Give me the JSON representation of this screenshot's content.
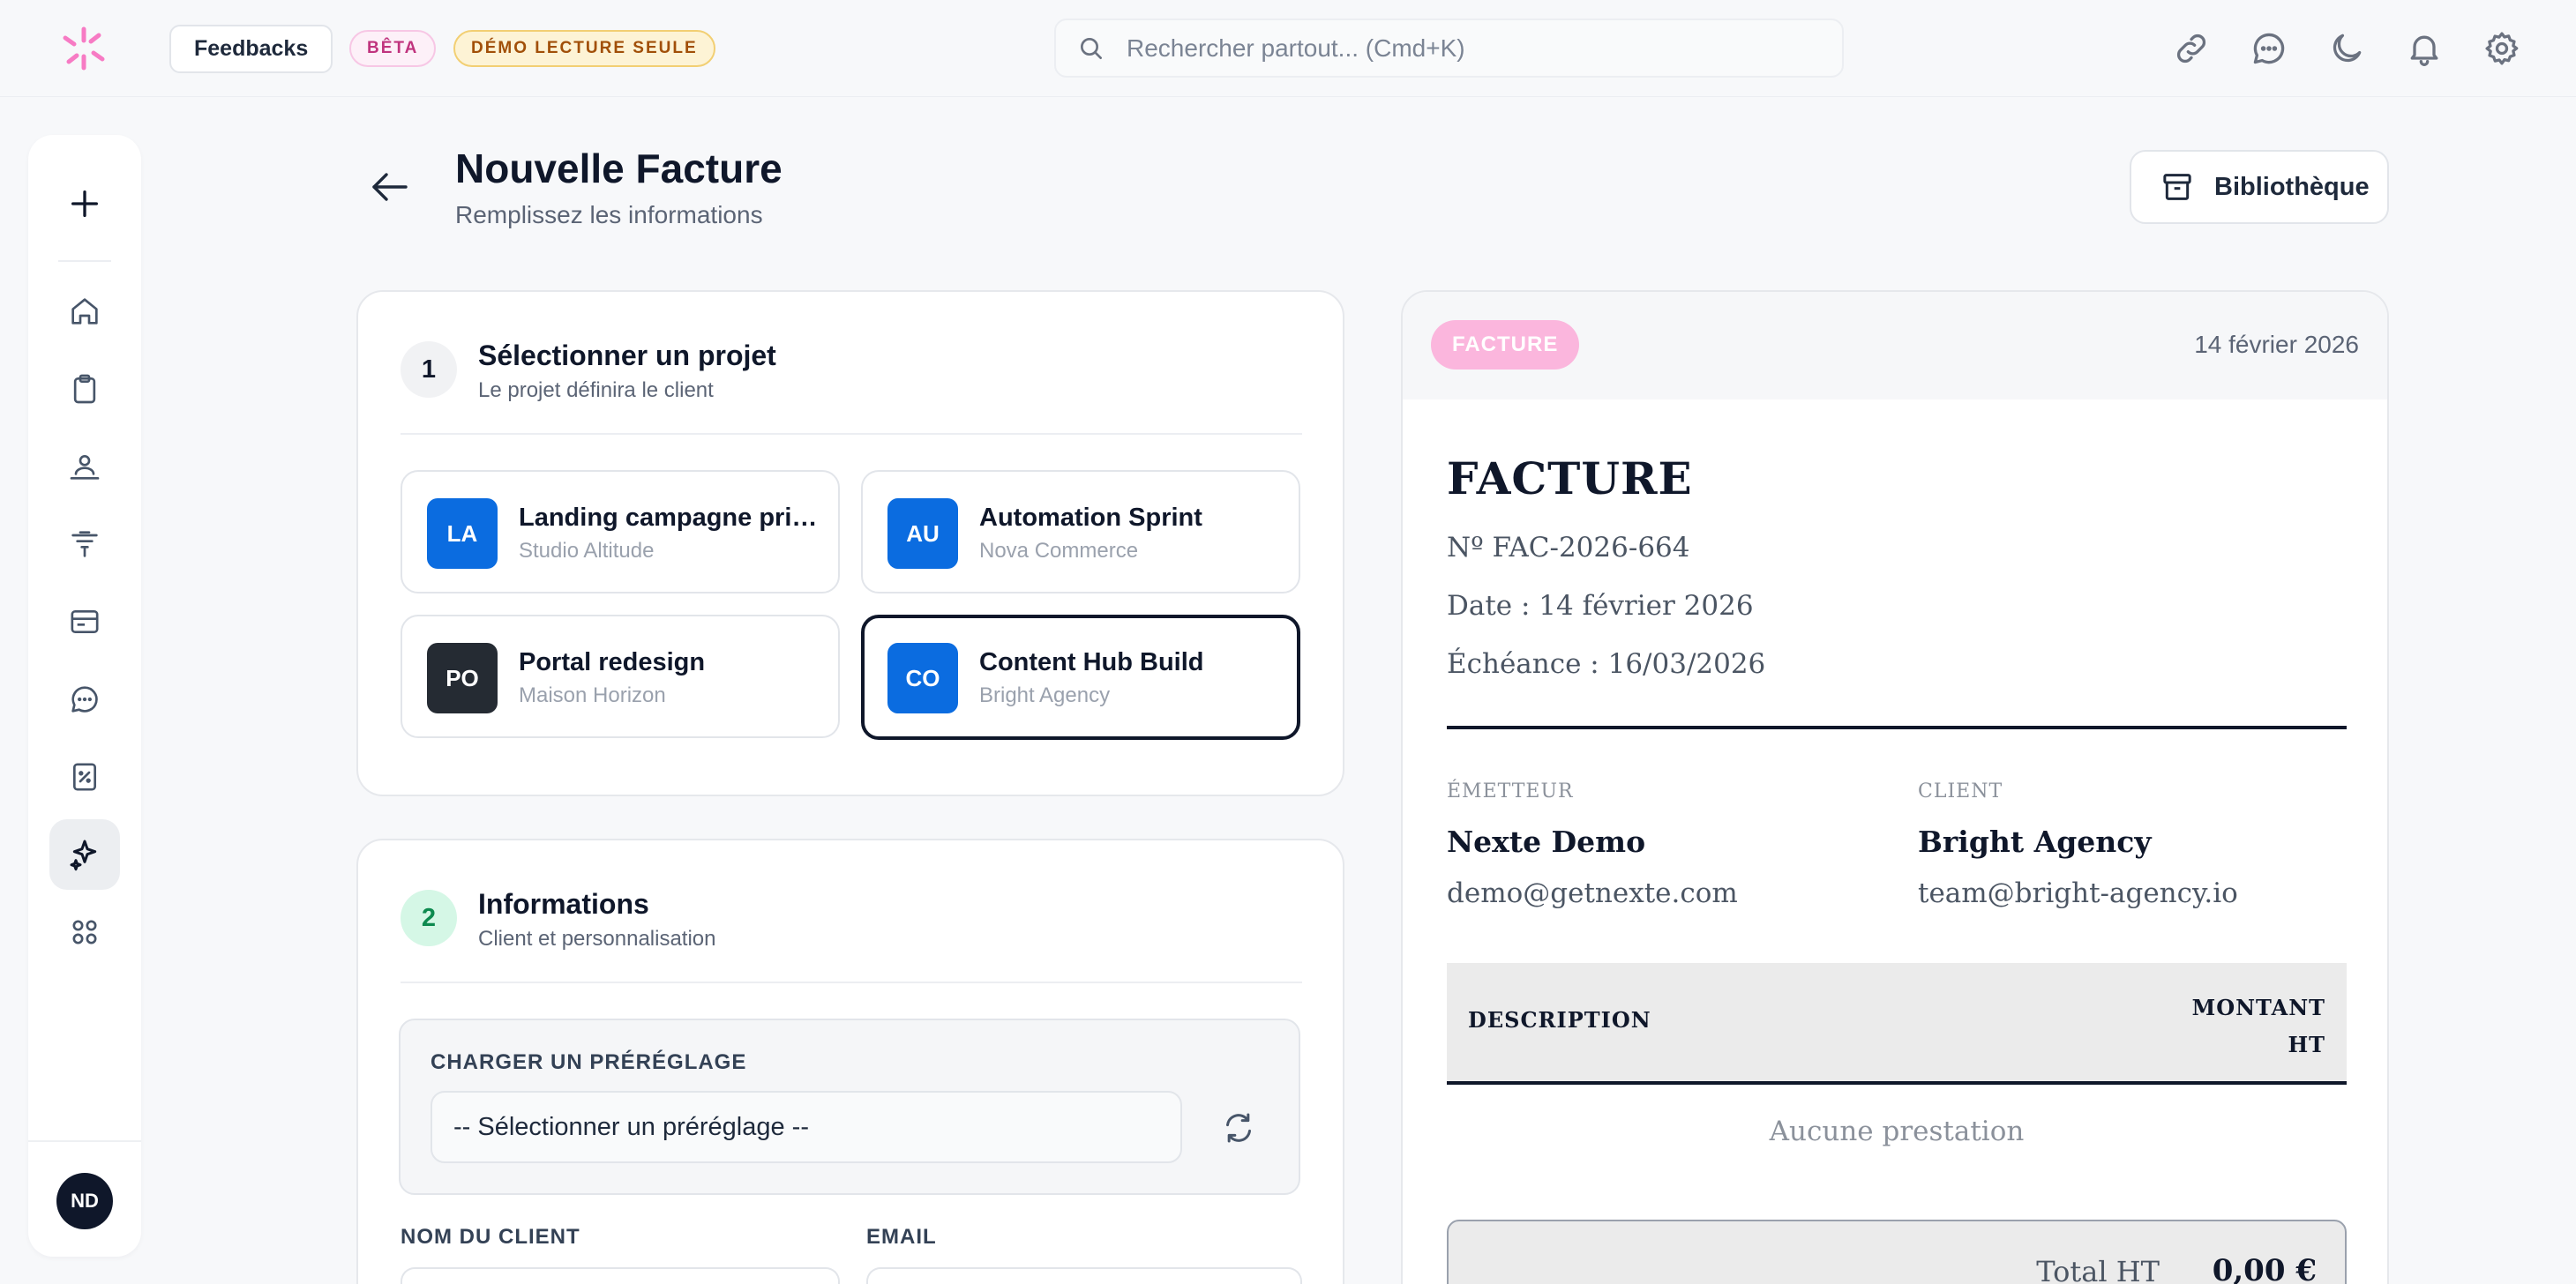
{
  "colors": {
    "accent": "#0f172a",
    "project_blue": "#0b6ce0",
    "project_dark": "#252b33",
    "step1_bg": "#f1f2f4",
    "step2_bg": "#d5f7e6",
    "step2_text": "#0d8a4f",
    "invoice_badge": "#fbb6dd"
  },
  "topbar": {
    "logo_icon": "nexte-logo-icon",
    "feedback_label": "Feedbacks",
    "beta_badge": "BÊTA",
    "demo_badge": "DÉMO LECTURE SEULE",
    "search_placeholder": "Rechercher partout... (Cmd+K)",
    "icons": [
      "link-icon",
      "chat-icon",
      "moon-icon",
      "bell-icon",
      "gear-icon"
    ]
  },
  "sidebar": {
    "items": [
      "plus-icon",
      "home-icon",
      "clipboard-icon",
      "team-icon",
      "filter-icon",
      "archive-icon",
      "chat-icon",
      "receipt-icon",
      "sparkle-icon",
      "grid-icon"
    ],
    "active": "sparkle-icon",
    "avatar_initials": "ND"
  },
  "header": {
    "title": "Nouvelle Facture",
    "subtitle": "Remplissez les informations",
    "library_label": "Bibliothèque"
  },
  "step1": {
    "number": "1",
    "title": "Sélectionner un projet",
    "subtitle": "Le projet définira le client",
    "projects": [
      {
        "initials": "LA",
        "name": "Landing campagne printemps",
        "client": "Studio Altitude"
      },
      {
        "initials": "AU",
        "name": "Automation Sprint",
        "client": "Nova Commerce"
      },
      {
        "initials": "PO",
        "name": "Portal redesign",
        "client": "Maison Horizon"
      },
      {
        "initials": "CO",
        "name": "Content Hub Build",
        "client": "Bright Agency"
      }
    ],
    "selected_project": "Content Hub Build"
  },
  "step2": {
    "number": "2",
    "title": "Informations",
    "subtitle": "Client et personnalisation",
    "preset_label": "CHARGER UN PRÉRÉGLAGE",
    "preset_value": "-- Sélectionner un préréglage --",
    "client_name_label": "NOM DU CLIENT",
    "email_label": "EMAIL"
  },
  "preview": {
    "badge": "FACTURE",
    "date_header": "14 février 2026",
    "title": "FACTURE",
    "number": "Nº FAC-2026-664",
    "date_line": "Date : 14 février 2026",
    "due_line": "Échéance : 16/03/2026",
    "issuer_label": "ÉMETTEUR",
    "issuer_name": "Nexte Demo",
    "issuer_email": "demo@getnexte.com",
    "client_label": "CLIENT",
    "client_name": "Bright Agency",
    "client_email": "team@bright-agency.io",
    "col_description": "DESCRIPTION",
    "col_amount": "MONTANT HT",
    "empty_text": "Aucune prestation",
    "total_label": "Total HT",
    "total_value": "0,00 €"
  }
}
